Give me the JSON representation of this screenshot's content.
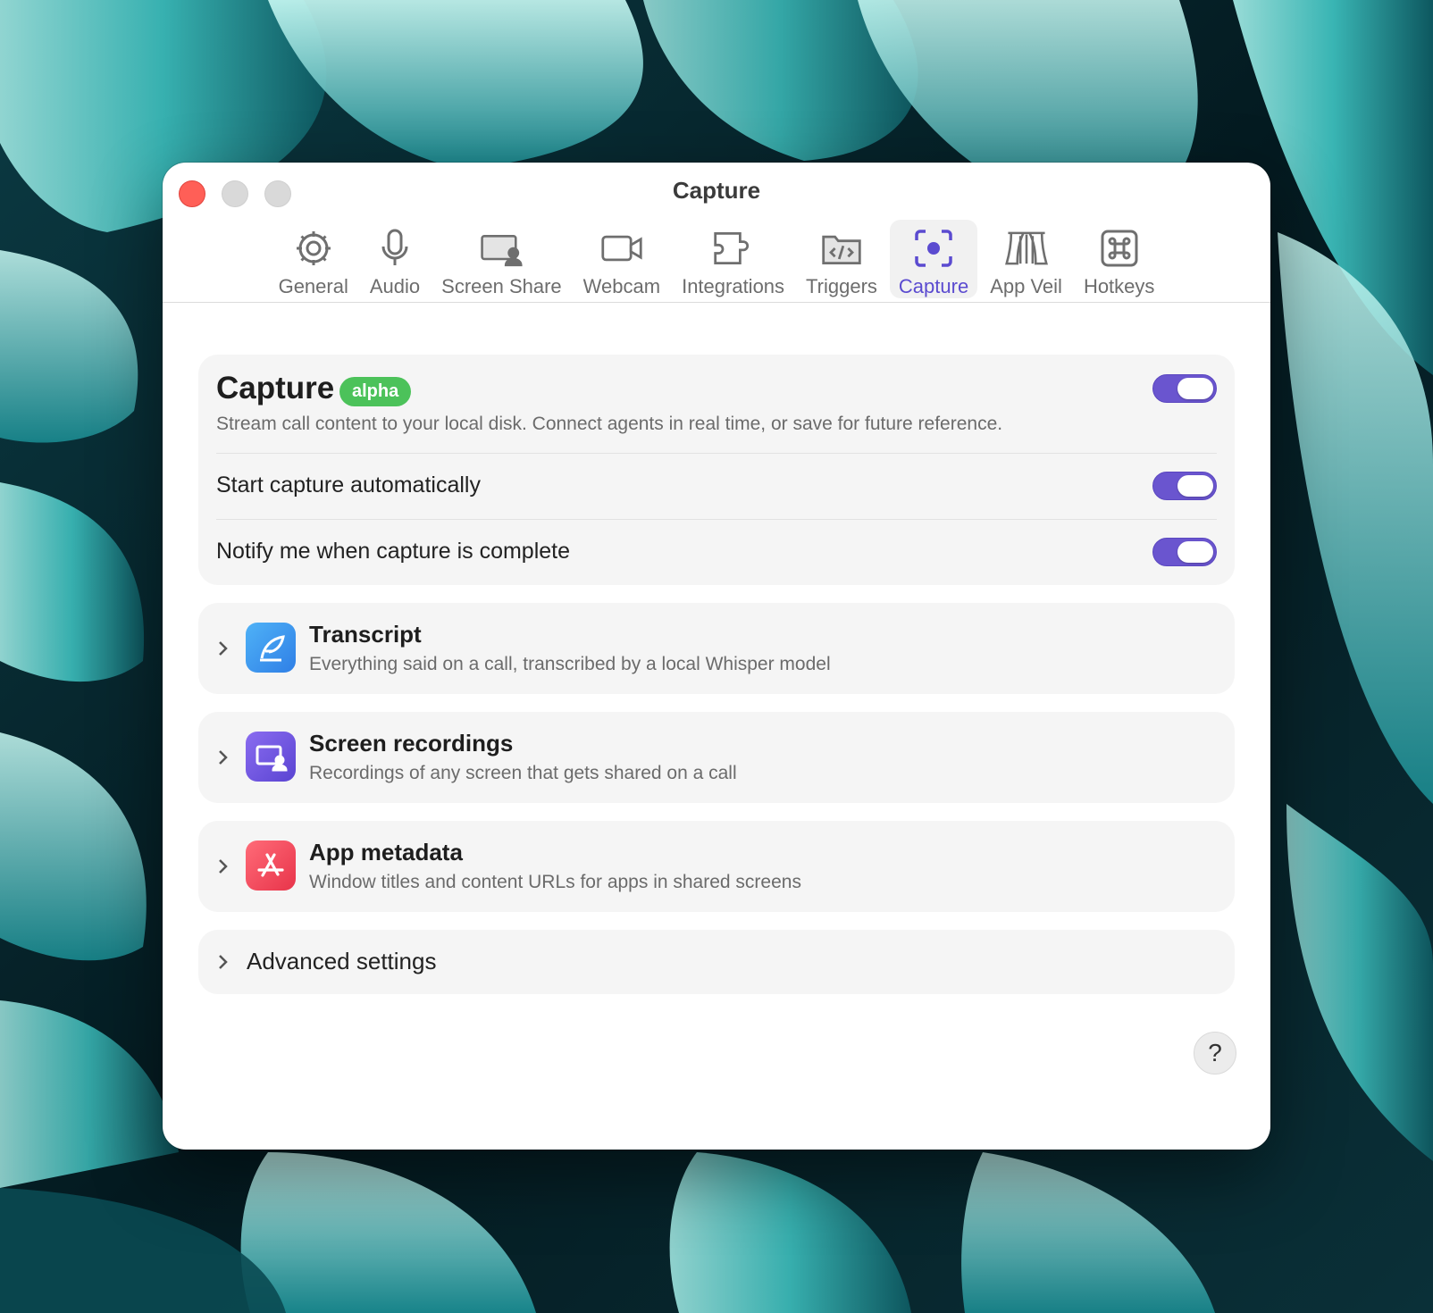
{
  "window": {
    "title": "Capture"
  },
  "tabs": [
    {
      "label": "General",
      "icon": "gear-icon"
    },
    {
      "label": "Audio",
      "icon": "microphone-icon"
    },
    {
      "label": "Screen Share",
      "icon": "screen-share-icon"
    },
    {
      "label": "Webcam",
      "icon": "video-camera-icon"
    },
    {
      "label": "Integrations",
      "icon": "puzzle-icon"
    },
    {
      "label": "Triggers",
      "icon": "code-folder-icon"
    },
    {
      "label": "Capture",
      "icon": "capture-record-icon",
      "active": true
    },
    {
      "label": "App Veil",
      "icon": "curtain-icon"
    },
    {
      "label": "Hotkeys",
      "icon": "command-key-icon"
    }
  ],
  "capture": {
    "title": "Capture",
    "badge": "alpha",
    "description": "Stream call content to your local disk. Connect agents in real time, or save for future reference.",
    "enabled": true
  },
  "settings": [
    {
      "label": "Start capture automatically",
      "enabled": true
    },
    {
      "label": "Notify me when capture is complete",
      "enabled": true
    }
  ],
  "features": [
    {
      "title": "Transcript",
      "description": "Everything said on a call, transcribed by a local Whisper model",
      "icon": "feather-icon"
    },
    {
      "title": "Screen recordings",
      "description": "Recordings of any screen that gets shared on a call",
      "icon": "screen-recording-icon"
    },
    {
      "title": "App metadata",
      "description": "Window titles and content URLs for apps in shared screens",
      "icon": "app-store-icon"
    }
  ],
  "advanced": {
    "label": "Advanced settings"
  },
  "help": {
    "label": "?"
  },
  "colors": {
    "accent": "#6a55cf",
    "badge_green": "#4cc25a",
    "close": "#ff5f57"
  }
}
